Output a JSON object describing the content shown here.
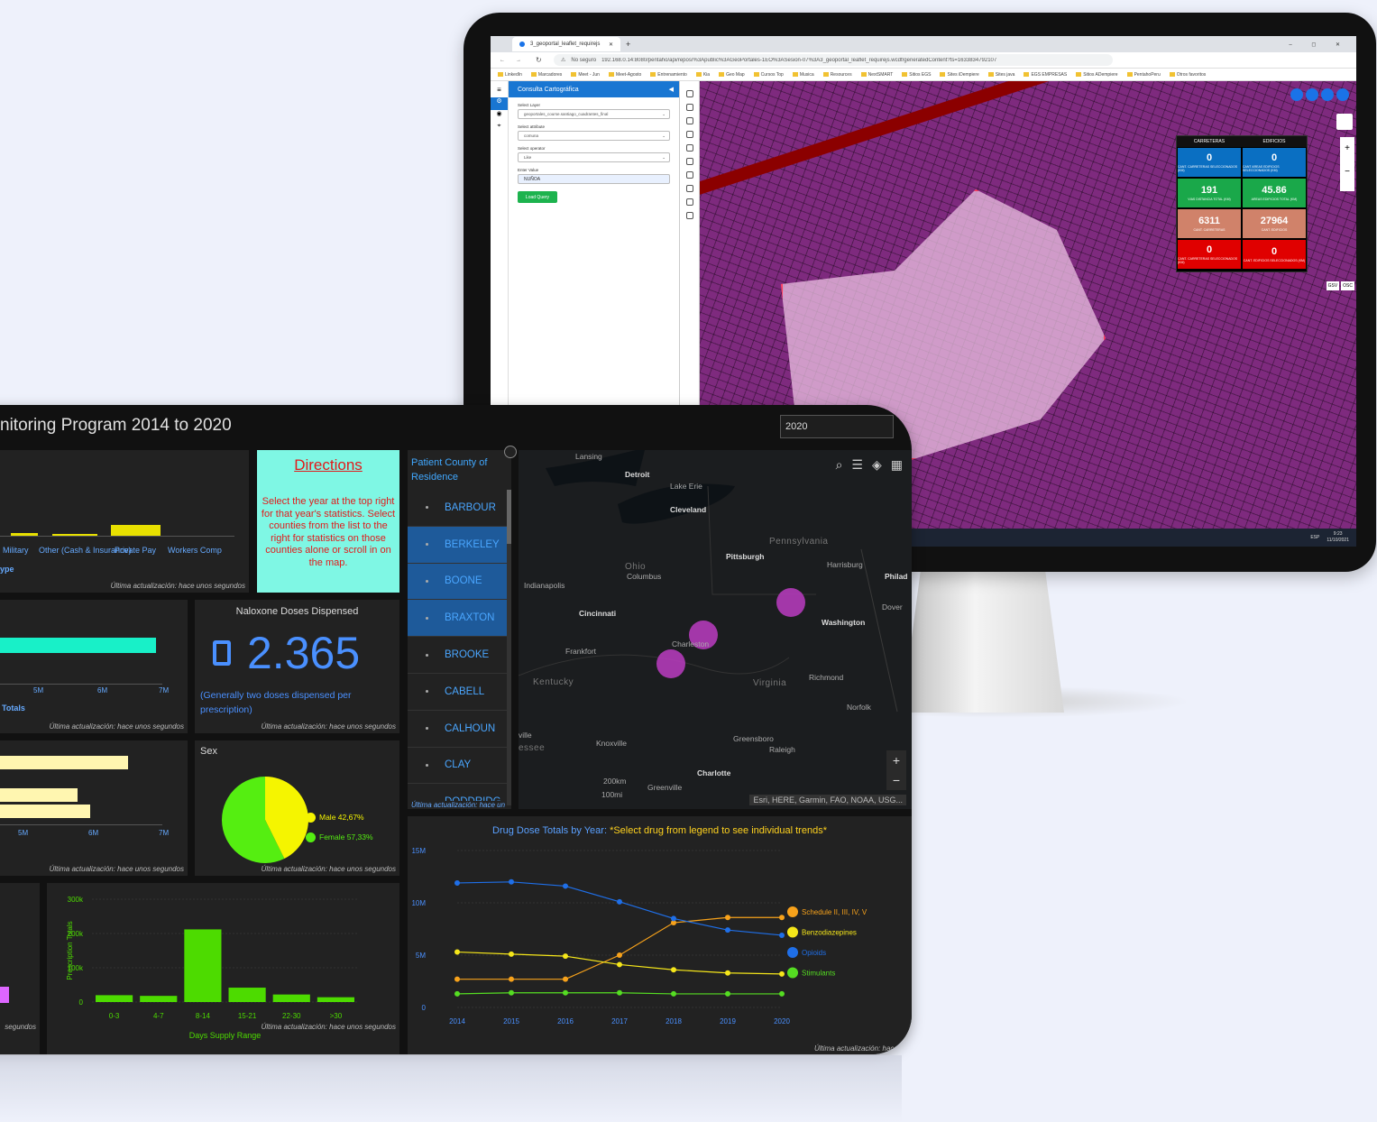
{
  "monitor": {
    "browser": {
      "tab_title": "3_geoportal_leaflet_requirejs",
      "url_prefix": "No seguro",
      "url": "192.168.0.14:8080/pentaho/api/repos/%3Apublic%3AGeoPortales-1EO%3ASesion-07%3A3_geoportal_leaflet_requirejs.wcdf/generatedContent?ts=1633834792107",
      "bookmarks": [
        "LinkedIn",
        "Marcadores",
        "Meet - Jun",
        "Meet-Agosto",
        "Entrenamiento",
        "Kia",
        "Geo Map",
        "Cursos Top",
        "Musica",
        "Resources",
        "NextSMART",
        "Sitios EGS",
        "Sites iDempiere",
        "Sites java",
        "EGS EMPRESAS",
        "Sitios ADempiere",
        "PentahoPeru",
        "Otros favoritos"
      ]
    },
    "query_panel": {
      "title": "Consulta Cartográfica",
      "layer_label": "Select Layer",
      "layer_value": "geoportales_course.santiago_cuadrantes_final",
      "attribute_label": "Select attribute",
      "attribute_value": "comuna",
      "operator_label": "Select operator",
      "operator_value": "Like",
      "value_label": "Enter Value",
      "value_value": "NUÑOA",
      "button": "Load Query"
    },
    "stats": {
      "head_left": "CARRETERAS",
      "head_right": "EDIFICIOS",
      "rows": [
        {
          "left": "0",
          "left_cap": "CANT. CARRETERAS SELECCIONADOS (KM)",
          "right": "0",
          "right_cap": "CANT AREAS EDIFICIOS SELECCIONADOS (KM)",
          "left_color": "#0a6fc2",
          "right_color": "#0a6fc2"
        },
        {
          "left": "191",
          "left_cap": "VIAS DISTANCIA TOTAL (KM)",
          "right": "45.86",
          "right_cap": "AREAS EDIFICIOS TOTAL (KM)",
          "left_color": "#1aa84a",
          "right_color": "#1aa84a"
        },
        {
          "left": "6311",
          "left_cap": "CANT. CARRETERAS",
          "right": "27964",
          "right_cap": "CANT. EDIFICIOS",
          "left_color": "#d0826a",
          "right_color": "#d0826a"
        },
        {
          "left": "0",
          "left_cap": "CANT. CARRETERAS SELECCIONADOS (KM)",
          "right": "0",
          "right_cap": "CANT. EDIFICIOS SELECCIONADOS (KM)",
          "left_color": "#e00000",
          "right_color": "#e00000"
        }
      ]
    },
    "map_buttons": [
      "GSV",
      "OSC"
    ],
    "taskbar": {
      "time": "9:23",
      "date": "11/10/2021",
      "lang": "ESP"
    }
  },
  "dashboard": {
    "title": "nitoring Program 2014 to 2020",
    "year": "2020",
    "payer_panel": {
      "categories": [
        "Military",
        "Other (Cash & Insurance)",
        "Private Pay",
        "Workers Comp"
      ],
      "axis_label": "ype",
      "footer": "Última actualización: hace unos segundos"
    },
    "directions": {
      "title": "Directions",
      "text": "Select the year at the top right for that year's statistics. Select counties from the list to the right for statistics on those counties alone or scroll in on the map."
    },
    "totals_panel": {
      "ticks": [
        "5M",
        "6M",
        "7M"
      ],
      "label": "Totals",
      "footer": "Última actualización: hace unos segundos"
    },
    "naloxone": {
      "title": "Naloxone Doses Dispensed",
      "value": "2.365",
      "note": "(Generally two doses dispensed per prescription)",
      "footer": "Última actualización: hace unos segundos"
    },
    "bars_panel": {
      "ticks": [
        "5M",
        "6M",
        "7M"
      ],
      "footer": "Última actualización: hace unos segundos"
    },
    "sex": {
      "title": "Sex",
      "male_label": "Male 42,67%",
      "female_label": "Female 57,33%",
      "male_pct": 42.67,
      "female_pct": 57.33,
      "footer": "Última actualización: hace unos segundos"
    },
    "county_list": {
      "header": "Patient County of Residence",
      "items": [
        {
          "name": "BARBOUR",
          "selected": false
        },
        {
          "name": "BERKELEY",
          "selected": true
        },
        {
          "name": "BOONE",
          "selected": true
        },
        {
          "name": "BRAXTON",
          "selected": true
        },
        {
          "name": "BROOKE",
          "selected": false
        },
        {
          "name": "CABELL",
          "selected": false
        },
        {
          "name": "CALHOUN",
          "selected": false
        },
        {
          "name": "CLAY",
          "selected": false
        },
        {
          "name": "DODDRIDG",
          "selected": false
        }
      ],
      "footer": "Última actualización: hace un"
    },
    "map": {
      "labels": [
        "Lansing",
        "Detroit",
        "Lake Erie",
        "Cleveland",
        "Pennsylvania",
        "Pittsburgh",
        "Harrisburg",
        "Philad",
        "Ohio",
        "Columbus",
        "Indianapolis",
        "Cincinnati",
        "Dover",
        "Washington",
        "Charleston",
        "Frankfort",
        "Kentucky",
        "Virginia",
        "Richmond",
        "Norfolk",
        "ville",
        "Knoxville",
        "essee",
        "Greensboro",
        "Raleigh",
        "Charlotte",
        "Greenville",
        "200km",
        "100mi"
      ],
      "attribution": "Esri, HERE, Garmin, FAO, NOAA, USG...",
      "zoom_in": "+",
      "zoom_out": "−"
    },
    "supply": {
      "ylabel": "Prescription Totals",
      "xlabel": "Days Supply Range",
      "footer": "Última actualización: hace unos segundos"
    },
    "drug_chart": {
      "title_prefix": "Drug Dose Totals by Year: ",
      "title_note": "*Select drug from legend to see individual trends*",
      "footer": "Última actualización: hace un"
    },
    "footer_left": "segundos"
  },
  "chart_data": [
    {
      "type": "bar",
      "title": "",
      "xlabel": "Days Supply Range",
      "ylabel": "Prescription Totals",
      "categories": [
        "0-3",
        "4-7",
        "8-14",
        "15-21",
        "22-30",
        ">30"
      ],
      "values": [
        20000,
        18000,
        212000,
        42000,
        22000,
        14000
      ],
      "ylim": [
        0,
        300000
      ],
      "yticks": [
        "0",
        "100k",
        "200k",
        "300k"
      ],
      "color": "#4ddb00"
    },
    {
      "type": "line",
      "title": "Drug Dose Totals by Year: *Select drug from legend to see individual trends*",
      "x": [
        "2014",
        "2015",
        "2016",
        "2017",
        "2018",
        "2019",
        "2020"
      ],
      "ylim": [
        0,
        15000000
      ],
      "yticks": [
        "0",
        "5M",
        "10M",
        "15M"
      ],
      "legend": "right",
      "series": [
        {
          "name": "Schedule II, III, IV, V",
          "color": "#f7a21b",
          "values": [
            2700000,
            2700000,
            2700000,
            5000000,
            8100000,
            8600000,
            8600000
          ]
        },
        {
          "name": "Benzodiazepines",
          "color": "#f5e61a",
          "values": [
            5300000,
            5100000,
            4900000,
            4100000,
            3600000,
            3300000,
            3200000
          ]
        },
        {
          "name": "Opioids",
          "color": "#1f6fe8",
          "values": [
            11900000,
            12000000,
            11600000,
            10100000,
            8500000,
            7400000,
            6900000
          ]
        },
        {
          "name": "Stimulants",
          "color": "#55dd22",
          "values": [
            1300000,
            1400000,
            1400000,
            1400000,
            1300000,
            1300000,
            1300000
          ]
        }
      ]
    },
    {
      "type": "pie",
      "title": "Sex",
      "categories": [
        "Male",
        "Female"
      ],
      "values": [
        42.67,
        57.33
      ],
      "colors": [
        "#f5f500",
        "#55ee11"
      ]
    }
  ]
}
